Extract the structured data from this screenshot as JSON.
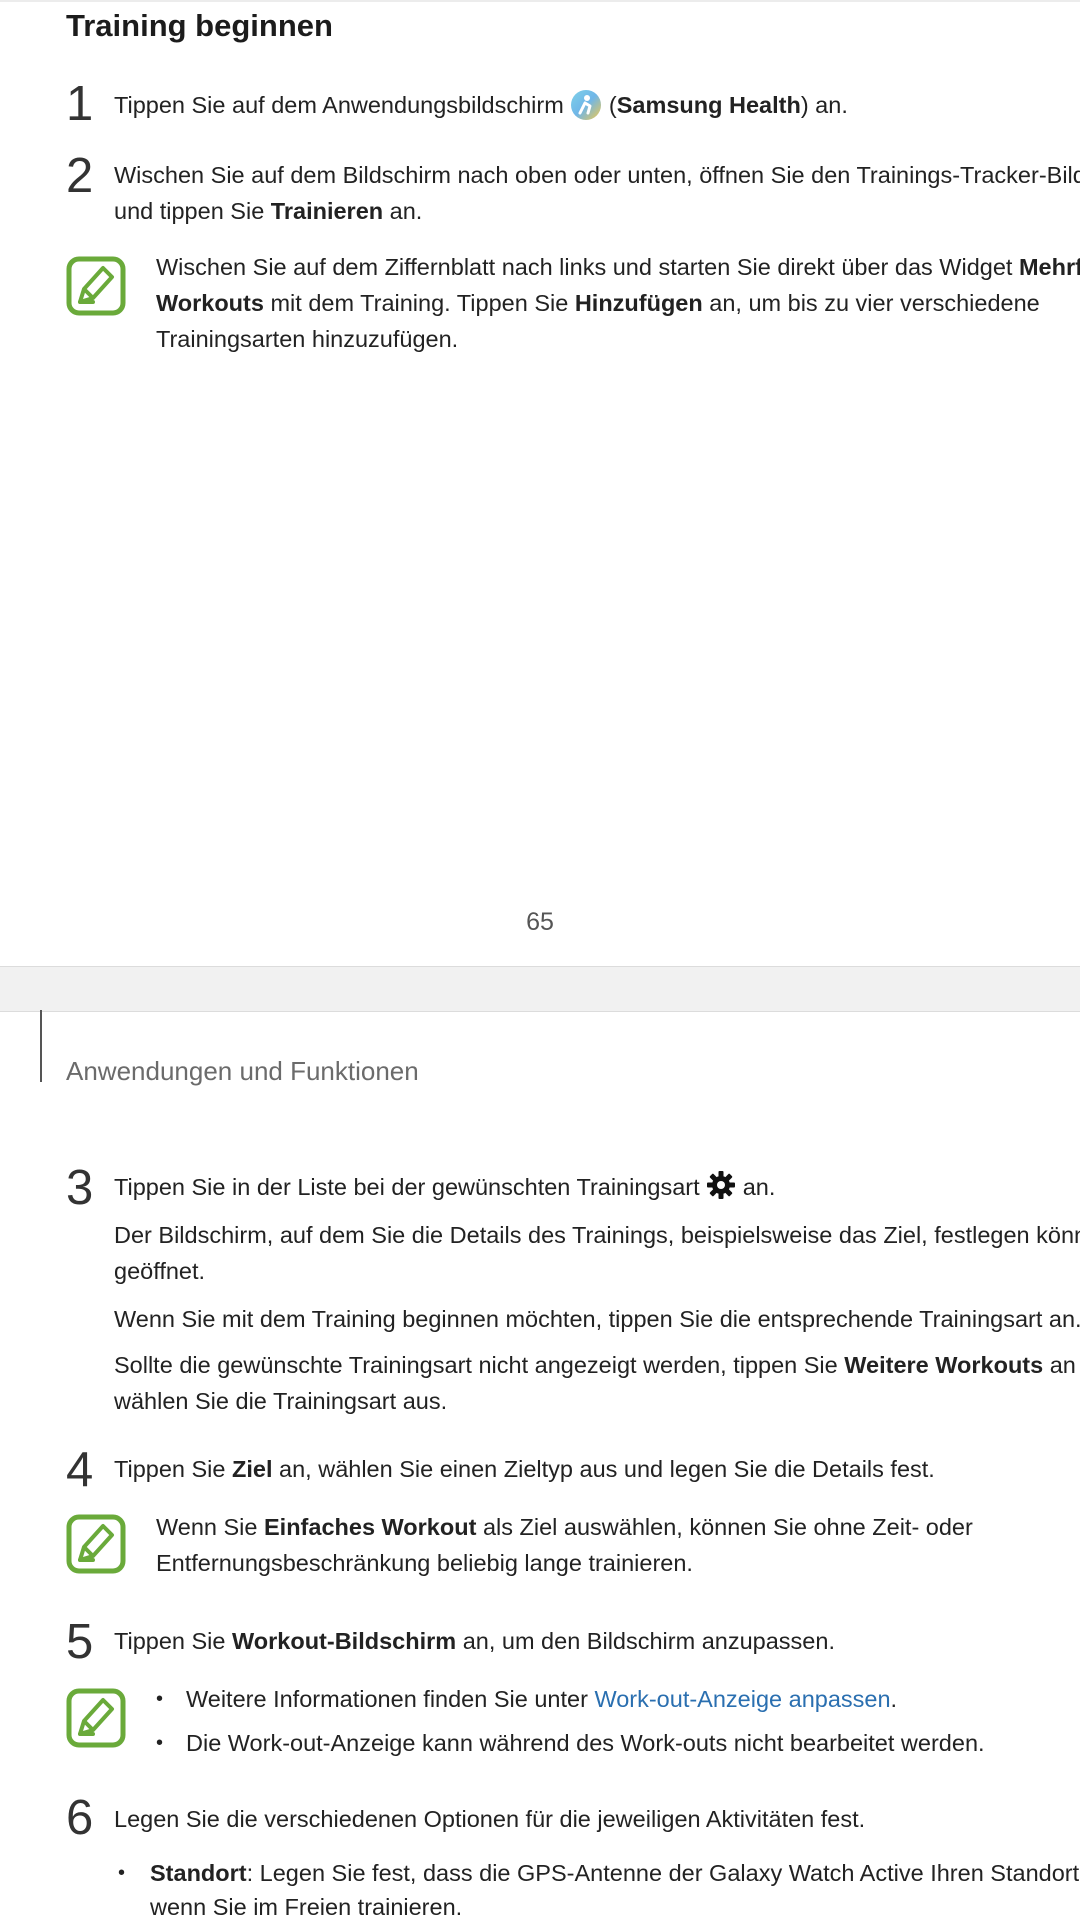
{
  "page1": {
    "heading": "Training beginnen",
    "step1": {
      "number": "1",
      "text_before": "Tippen Sie auf dem Anwendungsbildschirm",
      "app_open": "(",
      "app_name": "Samsung Health",
      "text_after": ") an."
    },
    "step2": {
      "number": "2",
      "line1": "Wischen Sie auf dem Bildschirm nach oben oder unten, öffnen Sie den Trainings-Tracker-Bildsch",
      "line2_before": "und tippen Sie",
      "line2_bold": "Trainieren",
      "line2_after": "an."
    },
    "note1": {
      "line1_before": "Wischen Sie auf dem Ziffernblatt nach links und starten Sie direkt über das Widget",
      "line1_bold": "Mehrfac",
      "line2_bold": "Workouts",
      "line2_mid": "mit dem Training. Tippen Sie",
      "line2_bold2": "Hinzufügen",
      "line2_after": "an, um bis zu vier verschiedene",
      "line3": "Trainingsarten hinzuzufügen."
    },
    "page_number": "65"
  },
  "page2": {
    "section_title": "Anwendungen und Funktionen",
    "step3": {
      "number": "3",
      "line1_before": "Tippen Sie in der Liste bei der gewünschten Trainingsart",
      "line1_after": "an.",
      "para1_line1": "Der Bildschirm, auf dem Sie die Details des Trainings, beispielsweise das Ziel, festlegen können,",
      "para1_line2": "geöffnet.",
      "para2": "Wenn Sie mit dem Training beginnen möchten, tippen Sie die entsprechende Trainingsart an.",
      "para3_line1_before": "Sollte die gewünschte Trainingsart nicht angezeigt werden, tippen Sie",
      "para3_line1_bold": "Weitere Workouts",
      "para3_line1_after": "an ur",
      "para3_line2": "wählen Sie die Trainingsart aus."
    },
    "step4": {
      "number": "4",
      "before": "Tippen Sie",
      "bold": "Ziel",
      "after": "an, wählen Sie einen Zieltyp aus und legen Sie die Details fest."
    },
    "note2": {
      "line1_before": "Wenn Sie",
      "line1_bold": "Einfaches Workout",
      "line1_after": "als Ziel auswählen, können Sie ohne Zeit- oder",
      "line2": "Entfernungsbeschränkung beliebig lange trainieren."
    },
    "step5": {
      "number": "5",
      "before": "Tippen Sie",
      "bold": "Workout-Bildschirm",
      "after": "an, um den Bildschirm anzupassen."
    },
    "note3": {
      "bullet1_before": "Weitere Informationen finden Sie unter",
      "bullet1_link": "Work-out-Anzeige anpassen",
      "bullet1_after": ".",
      "bullet2": "Die Work-out-Anzeige kann während des Work-outs nicht bearbeitet werden."
    },
    "step6": {
      "number": "6",
      "text": "Legen Sie die verschiedenen Optionen für die jeweiligen Aktivitäten fest.",
      "bullet1_bold": "Standort",
      "bullet1_after": ": Legen Sie fest, dass die GPS-Antenne der Galaxy Watch Active Ihren Standort erfa",
      "bullet1_line2": "wenn Sie im Freien trainieren."
    }
  },
  "colors": {
    "note_icon_green": "#6aaa3a",
    "link_blue": "#2a6fb0"
  },
  "icons": {
    "samsung_health": "samsung-health-app-icon",
    "note": "note-pencil-icon",
    "settings": "gear-icon"
  }
}
